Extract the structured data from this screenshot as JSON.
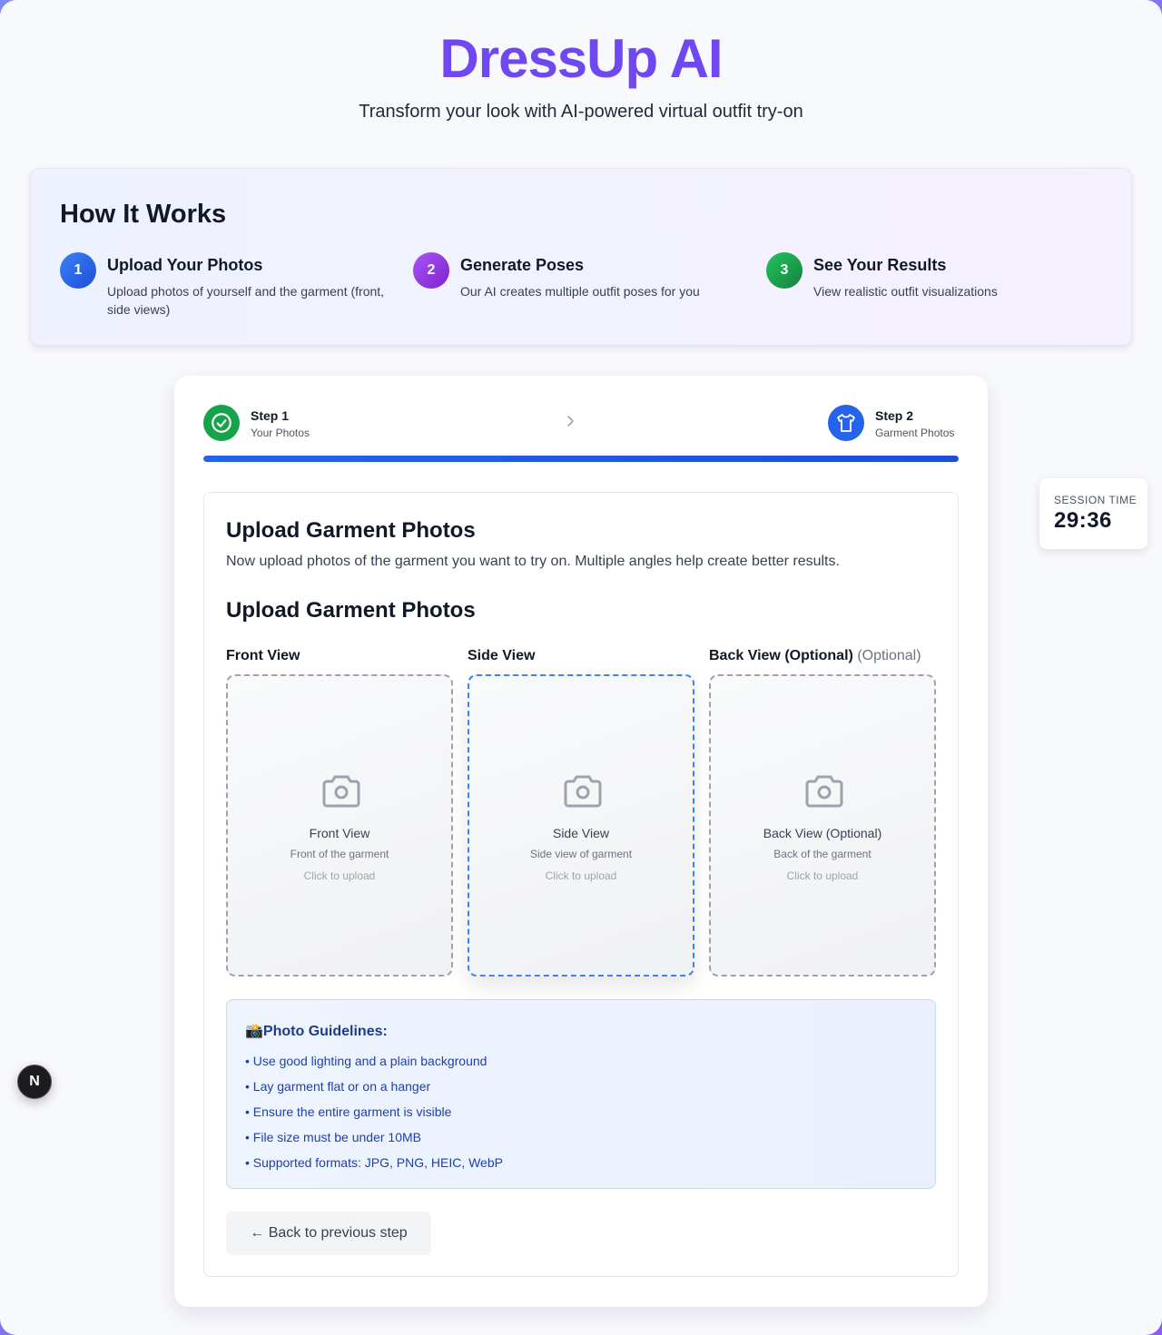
{
  "header": {
    "title": "DressUp AI",
    "subtitle": "Transform your look with AI-powered virtual outfit try-on"
  },
  "how_it_works": {
    "title": "How It Works",
    "steps": [
      {
        "number": "1",
        "title": "Upload Your Photos",
        "description": "Upload photos of yourself and the garment (front, side views)",
        "color": "#2563eb"
      },
      {
        "number": "2",
        "title": "Generate Poses",
        "description": "Our AI creates multiple outfit poses for you",
        "color": "#9333ea"
      },
      {
        "number": "3",
        "title": "See Your Results",
        "description": "View realistic outfit visualizations",
        "color": "#16a34a"
      }
    ]
  },
  "stepper": {
    "step1": {
      "label": "Step 1",
      "sub": "Your Photos",
      "icon": "check-circle-icon",
      "color": "#16a34a"
    },
    "step2": {
      "label": "Step 2",
      "sub": "Garment Photos",
      "icon": "shirt-icon",
      "color": "#2563eb"
    },
    "progress": 1.0
  },
  "upload": {
    "title": "Upload Garment Photos",
    "intro": "Now upload photos of the garment you want to try on. Multiple angles help create better results.",
    "section_title": "Upload Garment Photos",
    "columns": [
      {
        "label": "Front View",
        "optional_tag": "",
        "box_title": "Front View",
        "box_sub": "Front of the garment",
        "hint": "Click to upload"
      },
      {
        "label": "Side View",
        "optional_tag": "",
        "box_title": "Side View",
        "box_sub": "Side view of garment",
        "hint": "Click to upload"
      },
      {
        "label": "Back View (Optional)",
        "optional_tag": "(Optional)",
        "box_title": "Back View (Optional)",
        "box_sub": "Back of the garment",
        "hint": "Click to upload"
      }
    ]
  },
  "guidelines": {
    "title": "📸Photo Guidelines:",
    "items": [
      "Use good lighting and a plain background",
      "Lay garment flat or on a hanger",
      "Ensure the entire garment is visible",
      "File size must be under 10MB",
      "Supported formats: JPG, PNG, HEIC, WebP"
    ]
  },
  "back_button": {
    "label": "← Back to previous step"
  },
  "session": {
    "label": "SESSION TIME",
    "time": "29:36"
  },
  "dev_badge": {
    "letter": "N"
  }
}
